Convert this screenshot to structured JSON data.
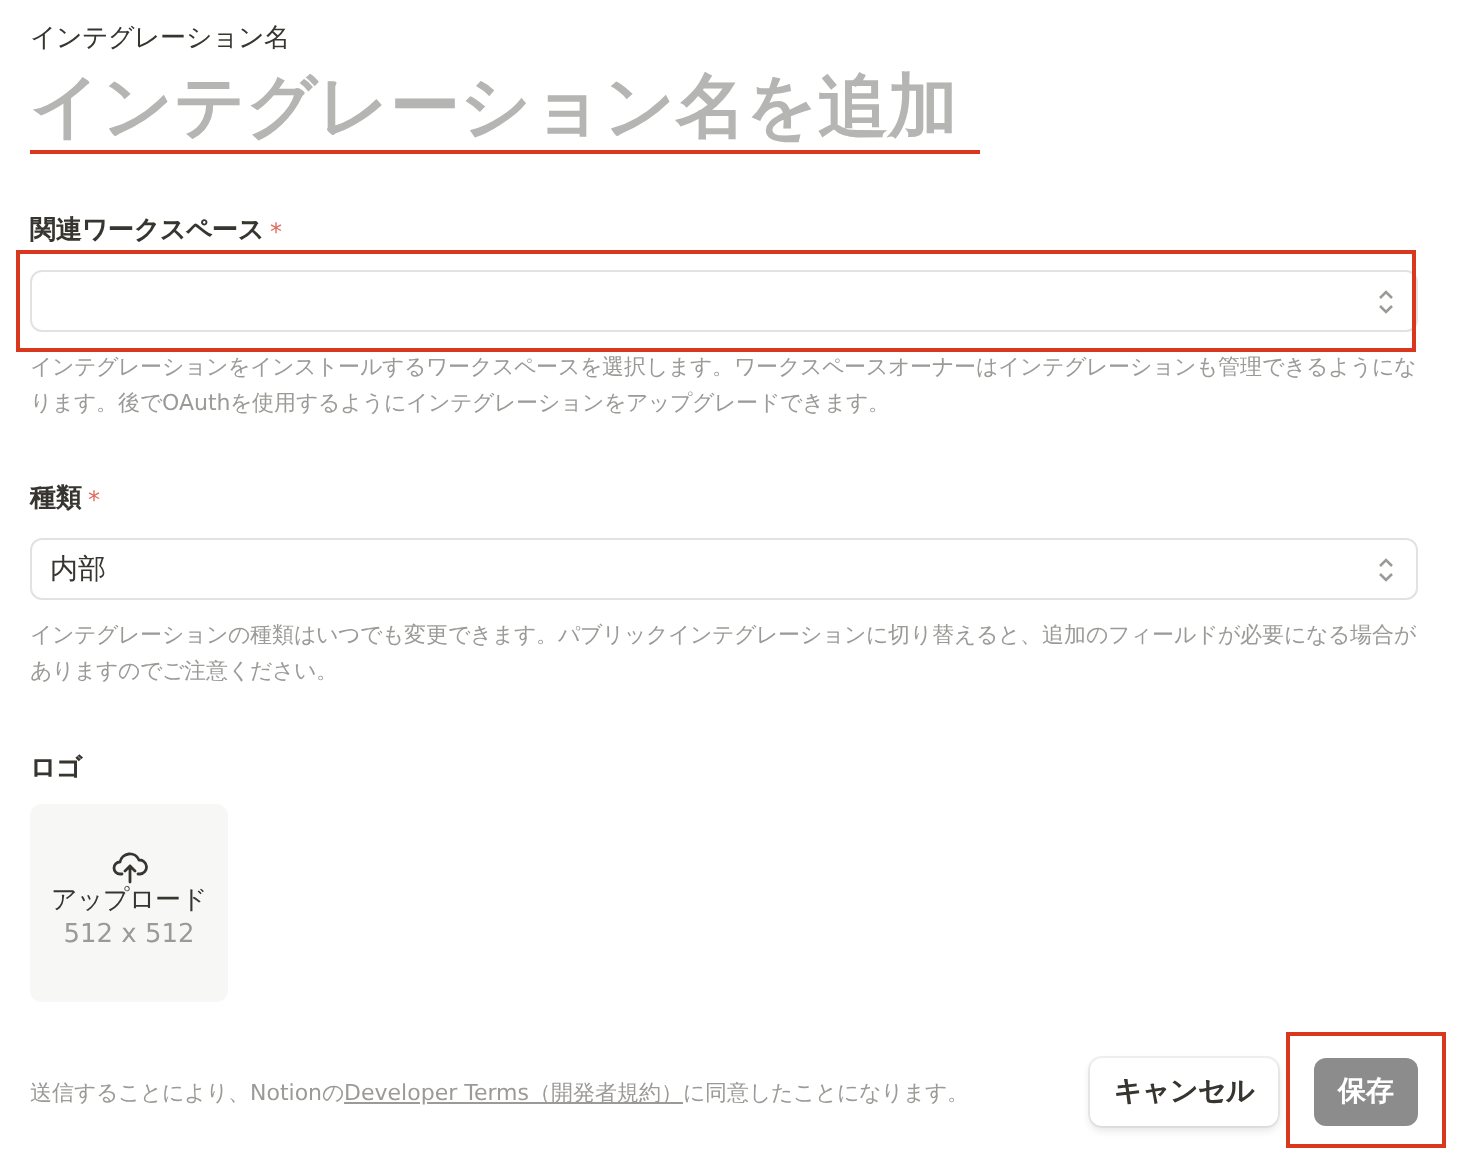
{
  "name_field": {
    "label": "インテグレーション名",
    "placeholder": "インテグレーション名を追加",
    "highlighted": true
  },
  "fields": [
    {
      "label": "関連ワークスペース",
      "required_mark": "*",
      "highlighted": true,
      "help": "インテグレーションをインストールするワークスペースを選択します。ワークスペースオーナーはインテグレーションも管理できるようになります。後でOAuthを使用するようにインテグレーションをアップグレードできます。"
    },
    {
      "label": "種類",
      "required_mark": "*",
      "value": "内部",
      "highlighted": false,
      "help": "インテグレーションの種類はいつでも変更できます。パブリックインテグレーションに切り替えると、追加のフィールドが必要になる場合がありますのでご注意ください。"
    }
  ],
  "logo": {
    "label": "ロゴ",
    "upload_label": "アップロード",
    "size": "512 x 512"
  },
  "footer": {
    "consent_prefix": "送信することにより、Notionの",
    "terms_link": "Developer Terms（開発者規約）",
    "consent_suffix": "に同意したことになります。",
    "buttons": [
      {
        "label": "キャンセル",
        "kind": "secondary",
        "highlighted": false,
        "disabled": false
      },
      {
        "label": "保存",
        "kind": "primary",
        "highlighted": true,
        "disabled": true
      }
    ]
  }
}
